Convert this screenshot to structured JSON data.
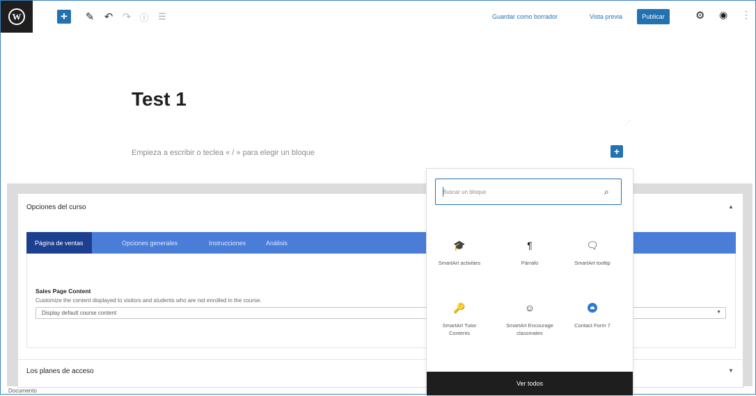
{
  "toolbar": {
    "save_draft": "Guardar como borrador",
    "preview": "Vista previa",
    "publish": "Publicar",
    "add_symbol": "+",
    "pencil_symbol": "✎",
    "undo_symbol": "↶",
    "redo_symbol": "↷",
    "info_symbol": "ⓘ",
    "list_symbol": "☰",
    "gear_symbol": "⚙",
    "plugin_symbol": "◉",
    "more_symbol": "⋮"
  },
  "editor": {
    "title": "Test 1",
    "placeholder": "Empieza a escribir o teclea « / » para elegir un bloque",
    "inline_add_symbol": "+"
  },
  "course_options": {
    "title": "Opciones del curso",
    "tabs": [
      "Página de ventas",
      "Opciones generales",
      "Instrucciones",
      "Análisis"
    ],
    "sales_page": {
      "label": "Sales Page Content",
      "description": "Customize the content displayed to visitors and students who are not enrolled in the course.",
      "select_value": "Display default course content"
    }
  },
  "access_plans": {
    "title": "Los planes de acceso"
  },
  "footer": {
    "breadcrumb": "Documento"
  },
  "inserter": {
    "search_placeholder": "Buscar un bloque",
    "blocks": [
      {
        "label": "SmartArt activities",
        "icon": "graduation-cap-icon",
        "glyph": "🎓"
      },
      {
        "label": "Párrafo",
        "icon": "paragraph-icon",
        "glyph": "¶"
      },
      {
        "label": "SmartArt tooltip",
        "icon": "tooltip-icon",
        "glyph": "🗨"
      },
      {
        "label": "SmartArt Tutor Contents",
        "icon": "key-icon",
        "glyph": "🔑"
      },
      {
        "label": "SmartArt Encourage classmates",
        "icon": "smile-icon",
        "glyph": "☺"
      },
      {
        "label": "Contact Form 7",
        "icon": "contact-form-icon",
        "glyph": ""
      }
    ],
    "view_all": "Ver todos"
  },
  "colors": {
    "accent": "#2271b1",
    "tabs_bar": "#4a7dd8",
    "tab_active": "#1d3f8f",
    "dark": "#1e1e1e"
  }
}
